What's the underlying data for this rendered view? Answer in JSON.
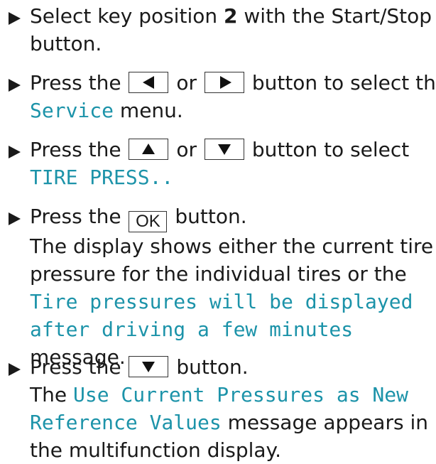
{
  "colors": {
    "text": "#1a1a1a",
    "display_text": "#1c93a9"
  },
  "steps": [
    {
      "a": "Select key position ",
      "b": "2",
      "c": " with the Start/Stop",
      "d": "button."
    },
    {
      "a": "Press the",
      "b": "or",
      "c": "button to select the",
      "d": "Service",
      "e": "menu."
    },
    {
      "a": "Press the",
      "b": "or",
      "c": "button to select",
      "d": "TIRE PRESS.."
    },
    {
      "a": "Press the",
      "key": "OK",
      "b": "button.",
      "c": "The display shows either the current tire",
      "d": "pressure for the individual tires or the",
      "e": "Tire pressures will be displayed",
      "f": "after driving a few minutes",
      "g": "message."
    },
    {
      "a": "Press the",
      "b": "button.",
      "c": "The",
      "d": "Use Current Pressures as New",
      "e": "Reference Values",
      "f": "message appears in",
      "g": "the multifunction display."
    }
  ]
}
